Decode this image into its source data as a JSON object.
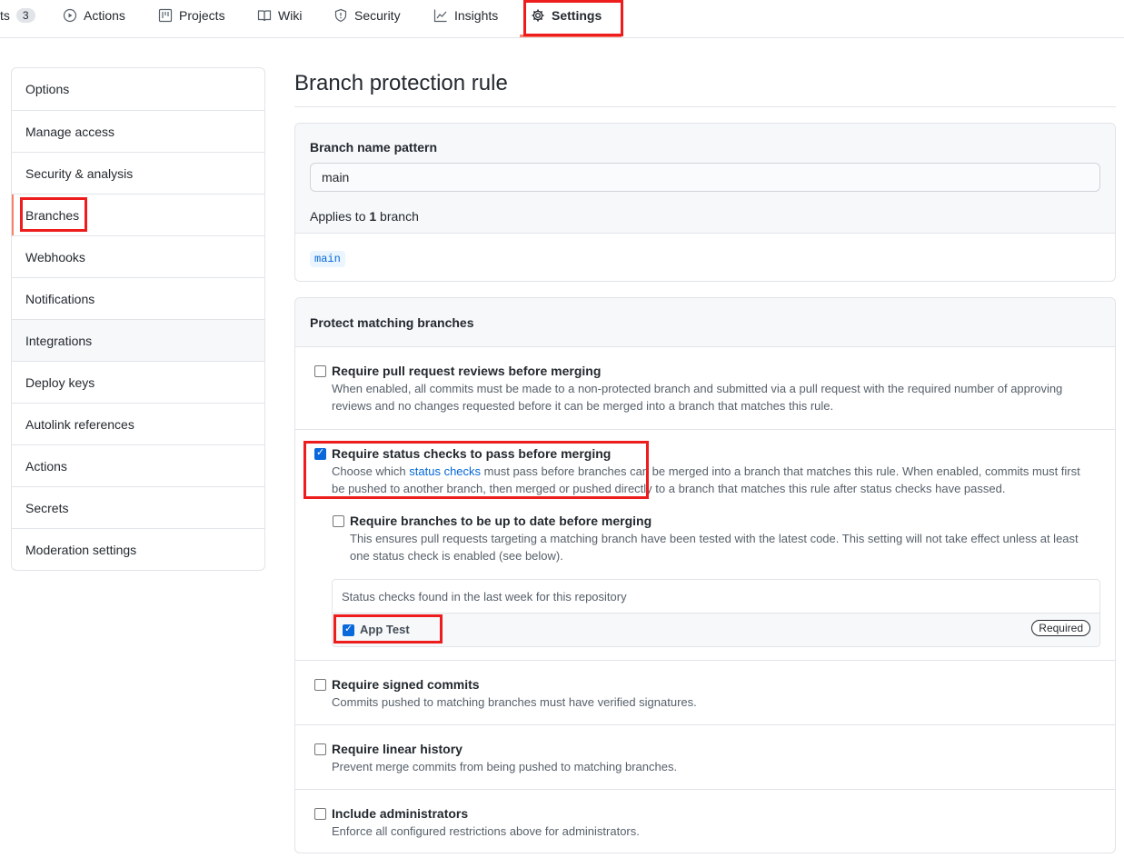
{
  "nav": {
    "partial_label": "ts",
    "partial_count": "3",
    "actions": "Actions",
    "projects": "Projects",
    "wiki": "Wiki",
    "security": "Security",
    "insights": "Insights",
    "settings": "Settings"
  },
  "sidebar": {
    "items": [
      {
        "label": "Options"
      },
      {
        "label": "Manage access"
      },
      {
        "label": "Security & analysis"
      },
      {
        "label": "Branches"
      },
      {
        "label": "Webhooks"
      },
      {
        "label": "Notifications"
      },
      {
        "label": "Integrations"
      },
      {
        "label": "Deploy keys"
      },
      {
        "label": "Autolink references"
      },
      {
        "label": "Actions"
      },
      {
        "label": "Secrets"
      },
      {
        "label": "Moderation settings"
      }
    ]
  },
  "main": {
    "title": "Branch protection rule",
    "pattern": {
      "label": "Branch name pattern",
      "value": "main",
      "applies_prefix": "Applies to ",
      "applies_count": "1",
      "applies_suffix": " branch",
      "branch": "main"
    },
    "protect": {
      "title": "Protect matching branches",
      "rules": {
        "reviews": {
          "title": "Require pull request reviews before merging",
          "desc": "When enabled, all commits must be made to a non-protected branch and submitted via a pull request with the required number of approving reviews and no changes requested before it can be merged into a branch that matches this rule.",
          "checked": false
        },
        "status": {
          "title": "Require status checks to pass before merging",
          "desc_prefix": "Choose which ",
          "desc_link": "status checks",
          "desc_suffix": " must pass before branches can be merged into a branch that matches this rule. When enabled, commits must first be pushed to another branch, then merged or pushed directly to a branch that matches this rule after status checks have passed.",
          "checked": true,
          "up_to_date": {
            "title": "Require branches to be up to date before merging",
            "desc": "This ensures pull requests targeting a matching branch have been tested with the latest code. This setting will not take effect unless at least one status check is enabled (see below).",
            "checked": false
          },
          "checks_header": "Status checks found in the last week for this repository",
          "check_item": {
            "label": "App Test",
            "badge": "Required",
            "checked": true
          }
        },
        "signed": {
          "title": "Require signed commits",
          "desc": "Commits pushed to matching branches must have verified signatures.",
          "checked": false
        },
        "linear": {
          "title": "Require linear history",
          "desc": "Prevent merge commits from being pushed to matching branches.",
          "checked": false
        },
        "admins": {
          "title": "Include administrators",
          "desc": "Enforce all configured restrictions above for administrators.",
          "checked": false
        }
      }
    }
  },
  "colors": {
    "highlight_box": "#ee1d1d",
    "link": "#0366d6",
    "checkbox_checked": "#0969da",
    "active_underline": "#f9826c"
  }
}
